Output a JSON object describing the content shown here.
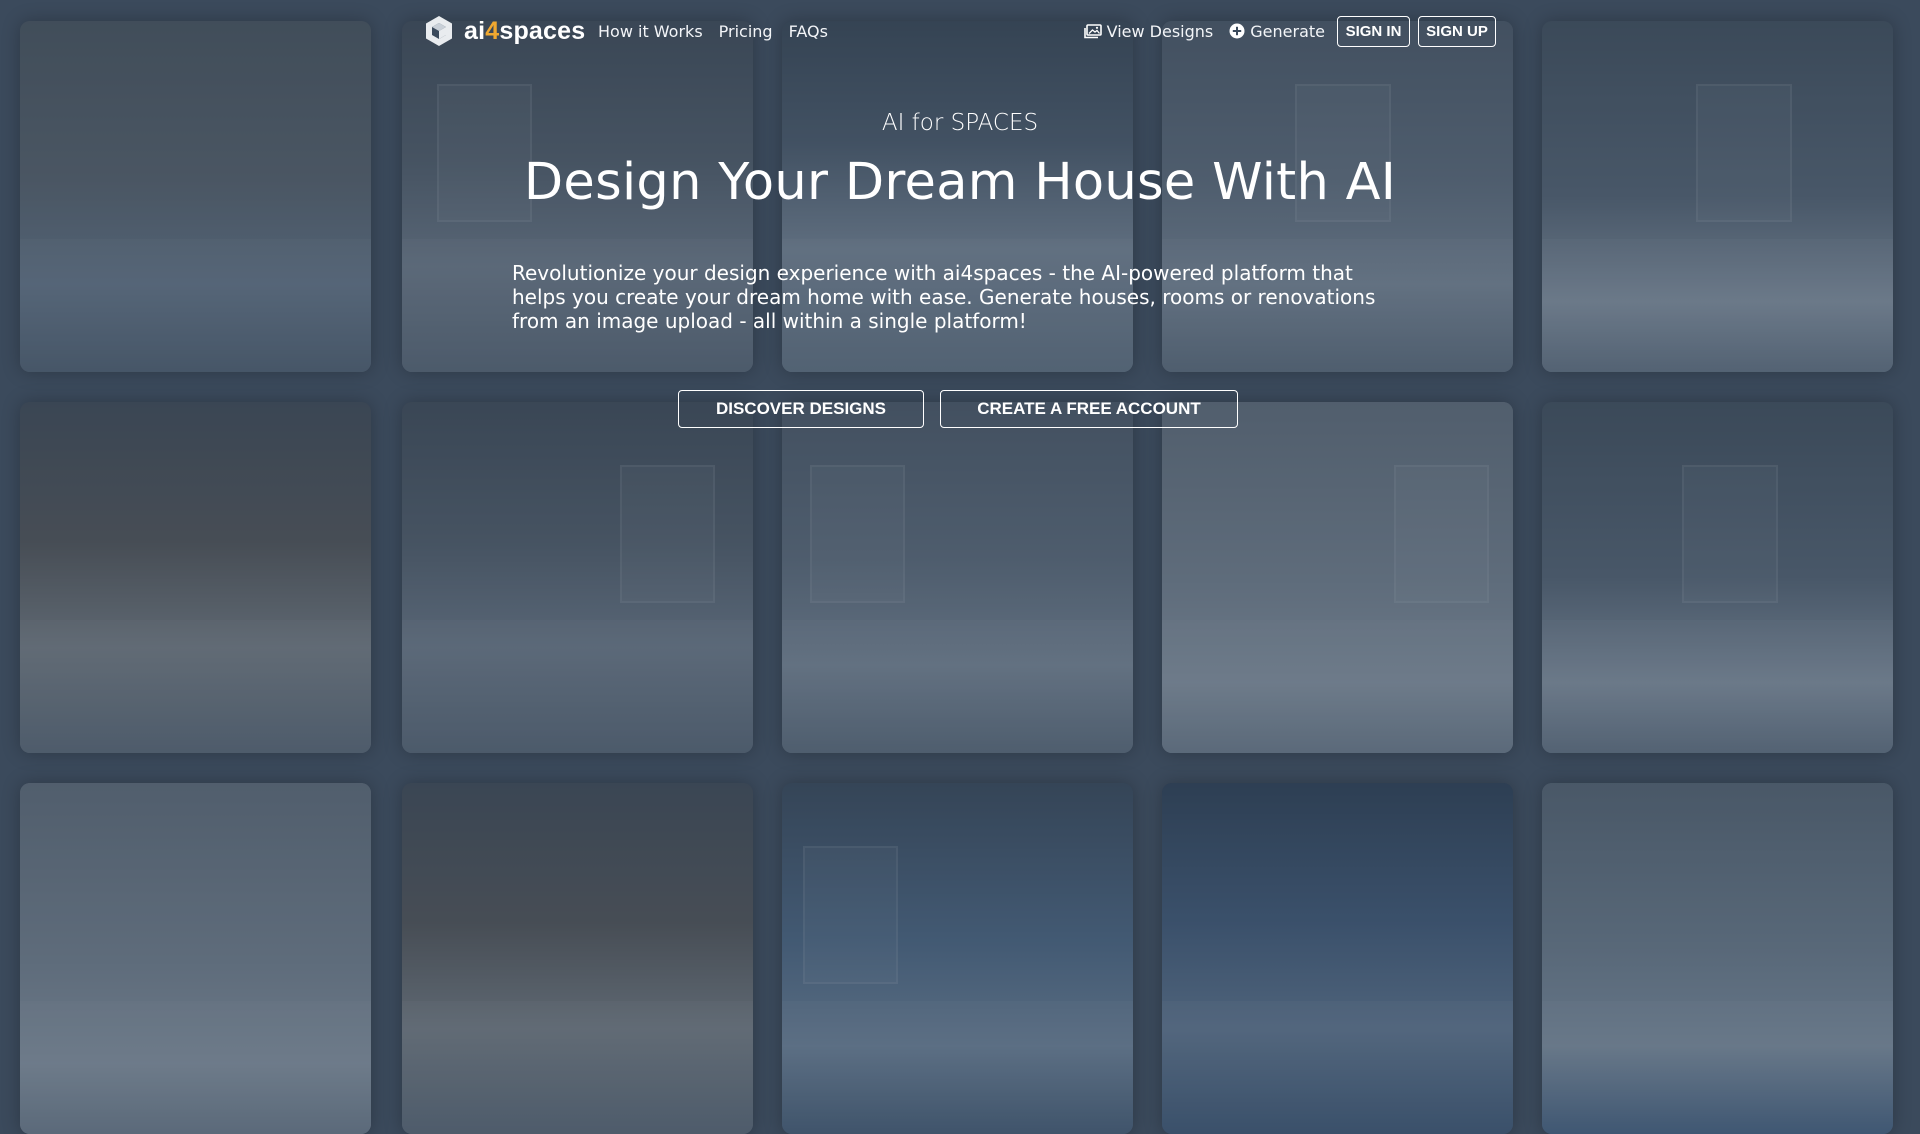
{
  "brand": {
    "name_prefix": "ai",
    "name_highlight": "4",
    "name_suffix": "spaces",
    "accent_color": "#f0a830",
    "logo_icon": "cube-logo-icon"
  },
  "nav": {
    "links": [
      "How it Works",
      "Pricing",
      "FAQs"
    ],
    "view_designs": {
      "label": "View Designs",
      "icon": "images-icon"
    },
    "generate": {
      "label": "Generate",
      "icon": "plus-circle-icon"
    },
    "sign_in": "SIGN IN",
    "sign_up": "SIGN UP"
  },
  "hero": {
    "subtitle": "AI for SPACES",
    "title": "Design Your Dream House With AI",
    "description": "Revolutionize your design experience with ai4spaces - the AI-powered platform that helps you create your dream home with ease. Generate houses, rooms or renovations from an image upload - all within a single platform!",
    "cta_primary": "DISCOVER DESIGNS",
    "cta_secondary": "CREATE A FREE ACCOUNT"
  },
  "background": {
    "overlay_color": "#3b4a5c"
  }
}
